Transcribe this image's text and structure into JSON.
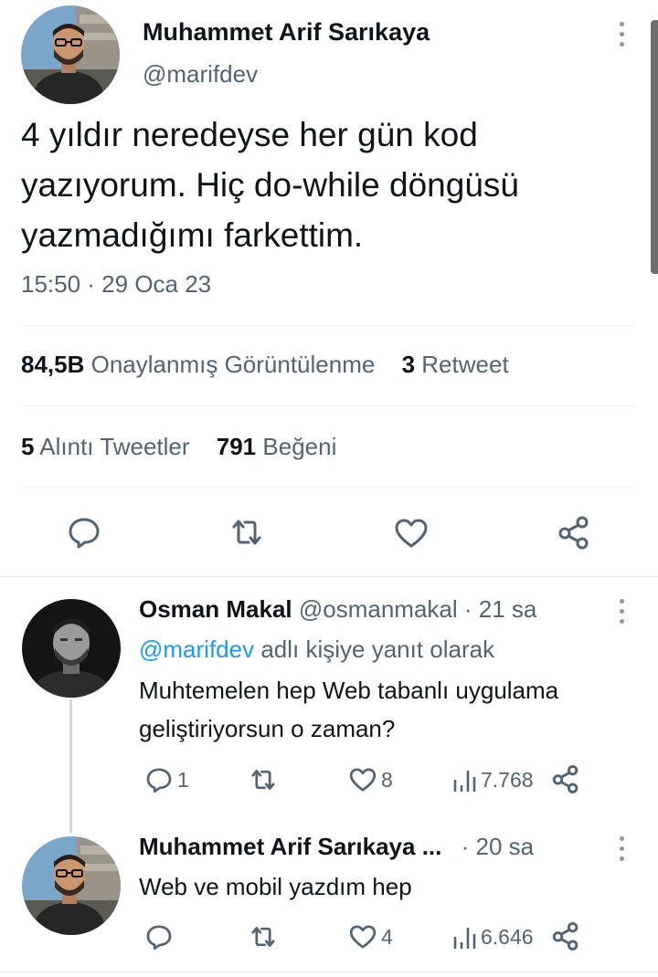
{
  "main_tweet": {
    "author_name": "Muhammet Arif Sarıkaya",
    "handle": "@marifdev",
    "text": "4 yıldır neredeyse her gün kod yazıyorum. Hiç do-while döngüsü yazmadığımı farkettim.",
    "timestamp": "15:50 · 29 Oca 23",
    "views_count": "84,5B",
    "views_label": "Onaylanmış Görüntülenme",
    "retweets_count": "3",
    "retweets_label": "Retweet",
    "quotes_count": "5",
    "quotes_label": "Alıntı Tweetler",
    "likes_count": "791",
    "likes_label": "Beğeni",
    "actions": [
      "reply-icon",
      "retweet-icon",
      "like-icon",
      "share-icon"
    ]
  },
  "replies": [
    {
      "author_name": "Osman Makal",
      "handle": "@osmanmakal",
      "time": "· 21 sa",
      "reply_to_mention": "@marifdev",
      "reply_to_suffix": "adlı kişiye yanıt olarak",
      "text": "Muhtemelen hep Web tabanlı uygulama geliştiriyorsun o zaman?",
      "reply_count": "1",
      "retweet_count": "",
      "like_count": "8",
      "view_count": "7.768"
    },
    {
      "author_name": "Muhammet Arif Sarıkaya ...",
      "handle": "",
      "time": "· 20 sa",
      "text": "Web ve mobil yazdım hep",
      "reply_count": "",
      "retweet_count": "",
      "like_count": "4",
      "view_count": "6.646"
    }
  ],
  "colors": {
    "accent": "#1d9bf0",
    "text_primary": "#0f1419",
    "text_secondary": "#536471",
    "divider": "#eff3f4"
  }
}
